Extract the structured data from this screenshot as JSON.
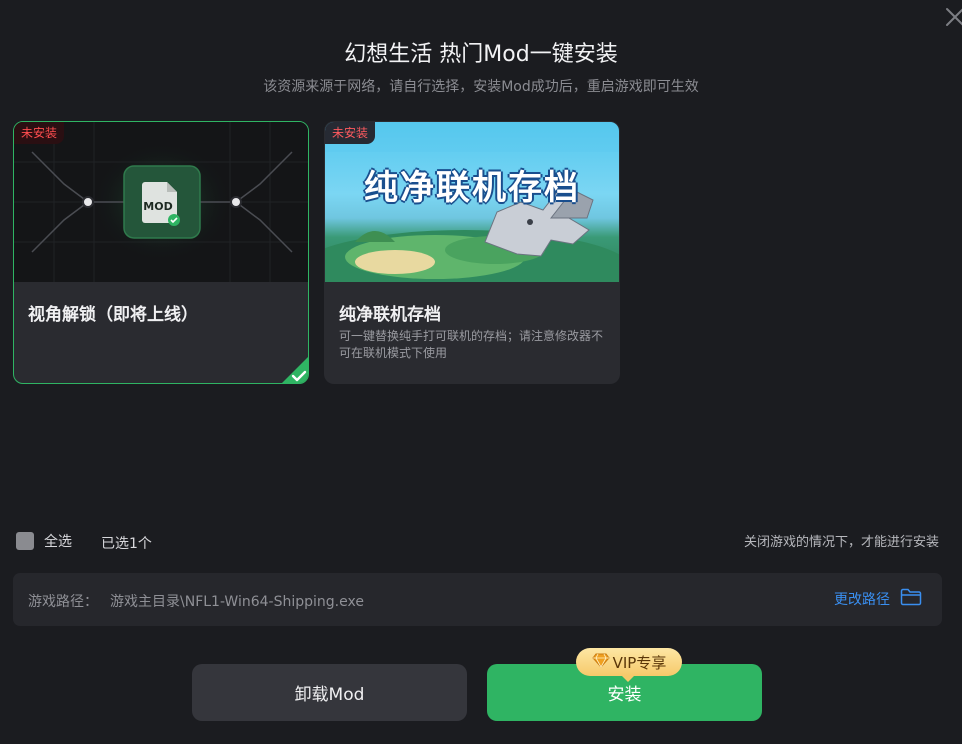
{
  "dialog": {
    "title": "幻想生活 热门Mod一键安装",
    "subtitle": "该资源来源于网络，请自行选择，安装Mod成功后，重启游戏即可生效"
  },
  "cards": [
    {
      "badge": "未安装",
      "title": "视角解锁（即将上线）",
      "description": "",
      "selected": true,
      "icon": "mod-file-icon",
      "icon_text": "MOD"
    },
    {
      "badge": "未安装",
      "title": "纯净联机存档",
      "description": "可一键替换纯手打可联机的存档；请注意修改器不可在联机模式下使用",
      "selected": false,
      "cover_text": "纯净联机存档"
    }
  ],
  "selection": {
    "select_all_label": "全选",
    "selected_count": "已选1个",
    "notice": "关闭游戏的情况下，才能进行安装"
  },
  "path": {
    "label": "游戏路径：",
    "value": "游戏主目录\\NFL1-Win64-Shipping.exe",
    "change_label": "更改路径"
  },
  "buttons": {
    "uninstall": "卸载Mod",
    "install": "安装",
    "vip_badge": "VIP专享"
  },
  "colors": {
    "accent_green": "#2fb463",
    "link_blue": "#3a8ff0",
    "badge_red": "#ff4d4f",
    "background": "#1b1c20"
  }
}
